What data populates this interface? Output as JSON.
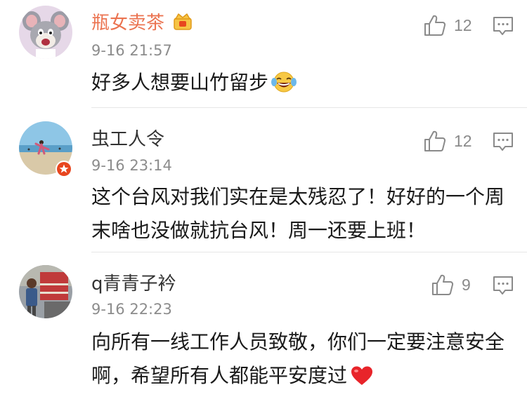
{
  "comments": [
    {
      "username": "瓶女卖茶",
      "time": "9-16 21:57",
      "text": "好多人想要山竹留步",
      "likes": "12",
      "avatar_icon": "cartoon-mouse-avatar",
      "badge_icon": "vip-crown-icon",
      "emoji_icon": "laughing-tears-emoji"
    },
    {
      "username": "虫工人令",
      "time": "9-16 23:14",
      "text": "这个台风对我们实在是太残忍了！好好的一个周末啥也没做就抗台风！周一还要上班！",
      "likes": "12",
      "avatar_icon": "beach-photo-avatar",
      "badge_icon": "verified-star-badge"
    },
    {
      "username": "q青青子衿",
      "time": "9-16 22:23",
      "text": "向所有一线工作人员致敬，你们一定要注意安全啊，希望所有人都能平安度过",
      "likes": "9",
      "avatar_icon": "street-photo-avatar",
      "emoji_icon": "red-heart-emoji"
    }
  ],
  "colors": {
    "vip_name": "#eb7350",
    "time": "#8c8c8c",
    "icon_gray": "#8a8a8a",
    "divider": "#e6e6e6",
    "badge_red": "#e8461f"
  }
}
